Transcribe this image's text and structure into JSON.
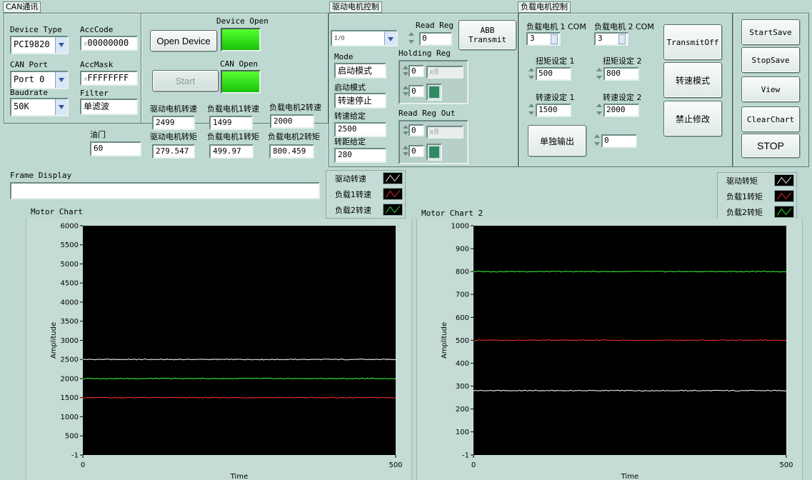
{
  "sections": {
    "can": "CAN通讯",
    "drive": "驱动电机控制",
    "load": "负载电机控制"
  },
  "can": {
    "device_type_label": "Device Type",
    "device_type_value": "PCI9820",
    "acc_code_label": "AccCode",
    "acc_code_prefix": "x",
    "acc_code_value": "00000000",
    "can_port_label": "CAN Port",
    "can_port_value": "Port 0",
    "acc_mask_label": "AccMask",
    "acc_mask_prefix": "x",
    "acc_mask_value": "FFFFFFFF",
    "baudrate_label": "Baudrate",
    "baudrate_value": "50K",
    "filter_label": "Filter",
    "filter_value": "单滤波",
    "device_open_label": "Device Open",
    "open_device_button": "Open Device",
    "can_open_label": "CAN Open",
    "start_button": "Start"
  },
  "readouts": {
    "drive_speed_label": "驱动电机转速",
    "drive_speed_value": "2499",
    "load1_speed_label": "负载电机1转速",
    "load1_speed_value": "1499",
    "load2_speed_label": "负载电机2转速",
    "load2_speed_value": "2000",
    "throttle_label": "油门",
    "throttle_value": "60",
    "drive_torque_label": "驱动电机转矩",
    "drive_torque_value": "279.547",
    "load1_torque_label": "负载电机1转矩",
    "load1_torque_value": "499.97",
    "load2_torque_label": "负载电机2转矩",
    "load2_torque_value": "800.459"
  },
  "frame": {
    "label": "Frame Display",
    "value": ""
  },
  "drive": {
    "selector_prefix": "I/O",
    "selector_value": "",
    "read_reg_label": "Read Reg",
    "read_reg_value": "0",
    "abb_button": "ABB Transmit",
    "mode_label": "Mode",
    "mode_value": "启动模式",
    "start_mode_label": "启动模式",
    "start_mode_value": "转速停止",
    "speed_set_label": "转速给定",
    "speed_set_value": "2500",
    "torque_set_label": "转距给定",
    "torque_set_value": "280",
    "holding_reg_label": "Holding Reg",
    "holding_reg_index": "0",
    "holding_reg_value": "x0",
    "holding_reg_index2": "0",
    "read_reg_out_label": "Read Reg Out",
    "read_reg_out_index": "0",
    "read_reg_out_value": "x0",
    "read_reg_out_index2": "0"
  },
  "load": {
    "com1_label": "负载电机 1 COM",
    "com1_value": "3",
    "com2_label": "负载电机 2 COM",
    "com2_value": "3",
    "torque1_label": "扭矩设定 1",
    "torque1_value": "500",
    "torque2_label": "扭矩设定 2",
    "torque2_value": "800",
    "speed1_label": "转速设定 1",
    "speed1_value": "1500",
    "speed2_label": "转速设定 2",
    "speed2_value": "2000",
    "single_output_button": "单独输出",
    "single_output_value": "0",
    "transmit_off_button": "TransmitOff",
    "speed_mode_button": "转速模式",
    "no_modify_button": "禁止修改"
  },
  "actions": {
    "start_save": "StartSave",
    "stop_save": "StopSave",
    "view": "View",
    "clear_chart": "ClearChart",
    "stop": "STOP"
  },
  "colors": {
    "background": "#bdd9d1",
    "plot_bg": "#000000",
    "series_white": "#ffffff",
    "series_red": "#ff3030",
    "series_green": "#33ff33",
    "led_on": "#33dd1a"
  },
  "chart_data": [
    {
      "type": "line",
      "title": "Motor Chart",
      "xlabel": "Time",
      "ylabel": "Amplitude",
      "xlim": [
        0,
        500
      ],
      "ylim": [
        -1,
        6000
      ],
      "x_ticks": [
        "0",
        "500"
      ],
      "y_ticks": [
        "6000",
        "5500",
        "5000",
        "4500",
        "4000",
        "3500",
        "3000",
        "2500",
        "2000",
        "1500",
        "1000",
        "500",
        "-1"
      ],
      "legend_position": "top-right",
      "series": [
        {
          "name": "驱动转速",
          "color": "#ffffff",
          "values": [
            2500,
            2500
          ]
        },
        {
          "name": "负载1转速",
          "color": "#ff3030",
          "values": [
            1500,
            1500
          ]
        },
        {
          "name": "负载2转速",
          "color": "#33ff33",
          "values": [
            2000,
            2000
          ]
        }
      ],
      "x": [
        0,
        500
      ]
    },
    {
      "type": "line",
      "title": "Motor Chart 2",
      "xlabel": "Time",
      "ylabel": "Amplitude",
      "xlim": [
        0,
        500
      ],
      "ylim": [
        -1,
        1000
      ],
      "x_ticks": [
        "0",
        "500"
      ],
      "y_ticks": [
        "1000",
        "900",
        "800",
        "700",
        "600",
        "500",
        "400",
        "300",
        "200",
        "100",
        "-1"
      ],
      "legend_position": "top-right",
      "series": [
        {
          "name": "驱动转矩",
          "color": "#ffffff",
          "values": [
            280,
            280
          ]
        },
        {
          "name": "负载1转矩",
          "color": "#ff3030",
          "values": [
            500,
            500
          ]
        },
        {
          "name": "负载2转矩",
          "color": "#33ff33",
          "values": [
            800,
            800
          ]
        }
      ],
      "x": [
        0,
        500
      ]
    }
  ]
}
